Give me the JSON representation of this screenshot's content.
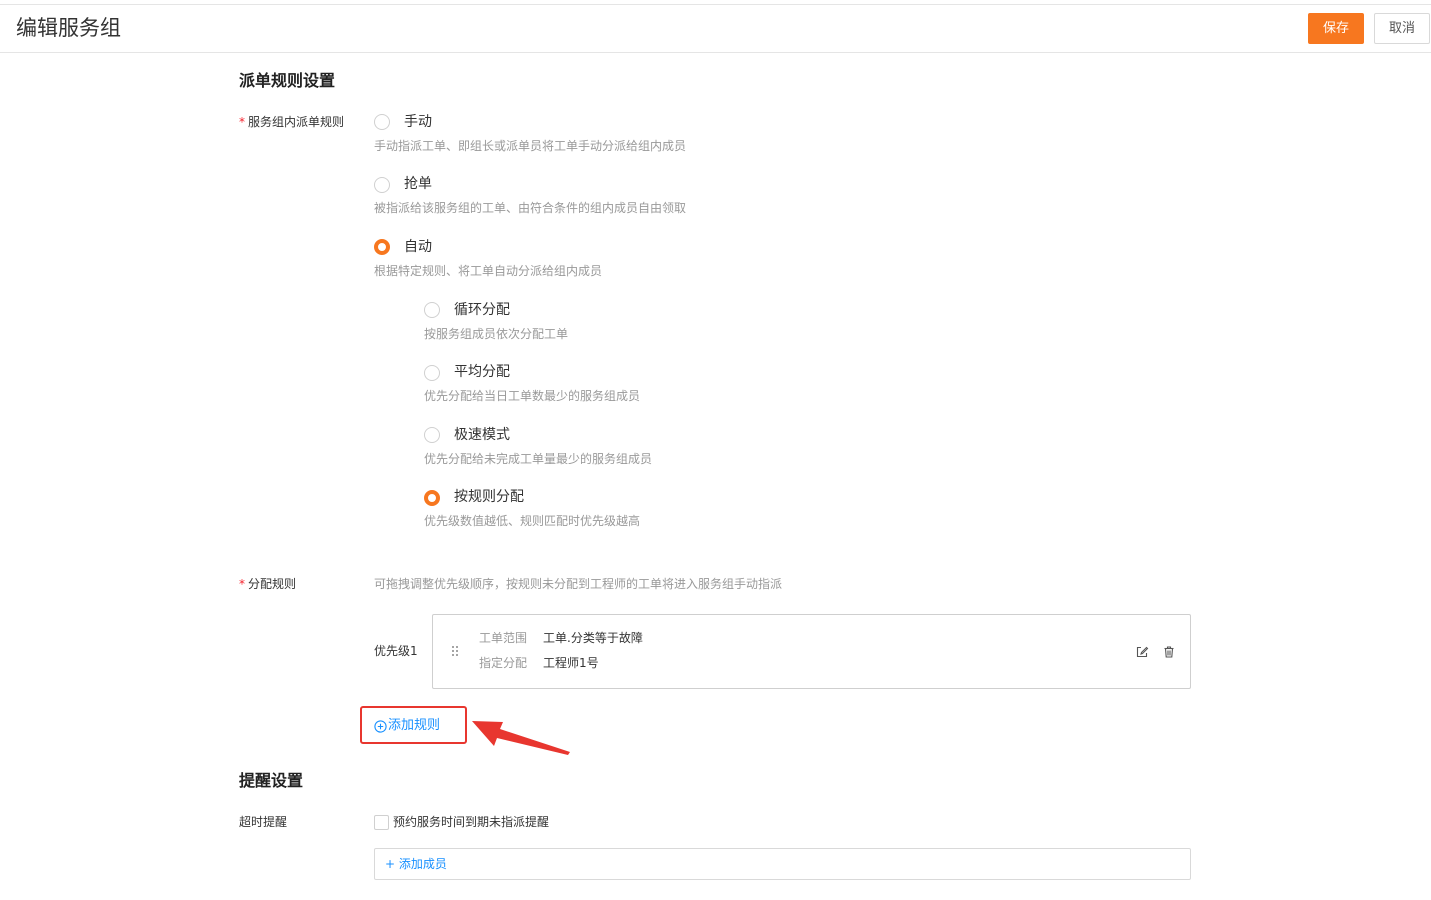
{
  "header": {
    "title": "编辑服务组",
    "save_label": "保存",
    "cancel_label": "取消"
  },
  "dispatch_section": {
    "title": "派单规则设置",
    "rule_label": "服务组内派单规则",
    "options": [
      {
        "label": "手动",
        "desc": "手动指派工单、即组长或派单员将工单手动分派给组内成员",
        "checked": false
      },
      {
        "label": "抢单",
        "desc": "被指派给该服务组的工单、由符合条件的组内成员自由领取",
        "checked": false
      },
      {
        "label": "自动",
        "desc": "根据特定规则、将工单自动分派给组内成员",
        "checked": true
      }
    ],
    "auto_options": [
      {
        "label": "循环分配",
        "desc": "按服务组成员依次分配工单",
        "checked": false
      },
      {
        "label": "平均分配",
        "desc": "优先分配给当日工单数最少的服务组成员",
        "checked": false
      },
      {
        "label": "极速模式",
        "desc": "优先分配给未完成工单量最少的服务组成员",
        "checked": false
      },
      {
        "label": "按规则分配",
        "desc": "优先级数值越低、规则匹配时优先级越高",
        "checked": true
      }
    ]
  },
  "allocation": {
    "label": "分配规则",
    "hint": "可拖拽调整优先级顺序，按规则未分配到工程师的工单将进入服务组手动指派",
    "rules": [
      {
        "priority": "优先级1",
        "scope_key": "工单范围",
        "scope_value": "工单.分类等于故障",
        "assign_key": "指定分配",
        "assign_value": "工程师1号"
      }
    ],
    "add_rule_label": "添加规则"
  },
  "reminder_section": {
    "title": "提醒设置",
    "timeout_label": "超时提醒",
    "checkbox_label": "预约服务时间到期未指派提醒",
    "checkbox_checked": false,
    "add_member_label": "+ 添加成员"
  },
  "colors": {
    "accent": "#f7771f",
    "link": "#1890ff",
    "annotation": "#e8362f"
  },
  "icons": {
    "drag": "drag-handle-icon",
    "edit": "edit-icon",
    "delete": "trash-icon",
    "add": "plus-circle-icon"
  }
}
